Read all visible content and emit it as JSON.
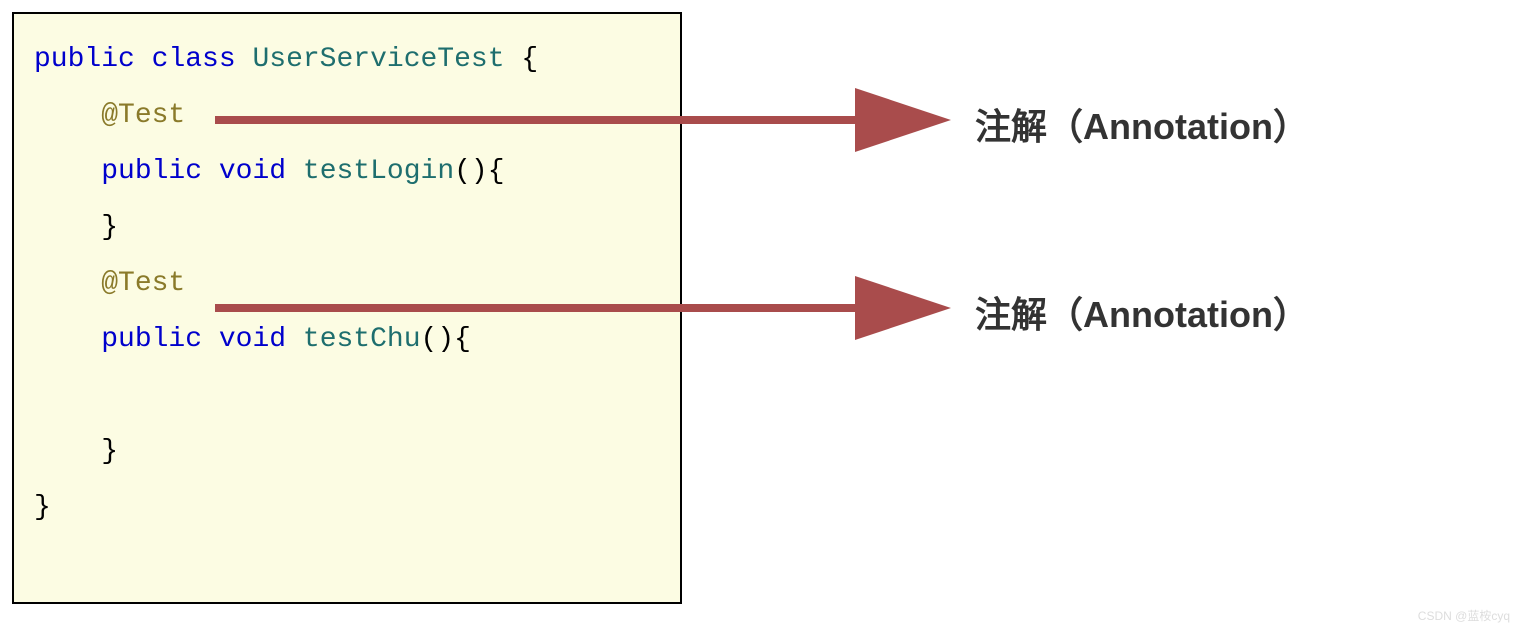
{
  "colors": {
    "keyword": "#0000cc",
    "identifier": "#1e6e6e",
    "annotation": "#8a7a2a",
    "plain": "#000000",
    "code_bg": "#fcfce3",
    "arrow": "#a94c4c",
    "label": "#333333"
  },
  "code": {
    "line1": {
      "kw1": "public",
      "sp1": " ",
      "kw2": "class",
      "sp2": " ",
      "id1": "UserServiceTest",
      "rest": " {"
    },
    "line2": {
      "indent": "    ",
      "anno": "@Test"
    },
    "line3": {
      "indent": "    ",
      "kw1": "public",
      "sp1": " ",
      "kw2": "void",
      "sp2": " ",
      "id1": "testLogin",
      "rest": "(){"
    },
    "line4": {
      "indent": "    ",
      "rest": "}"
    },
    "line5": {
      "indent": "    ",
      "anno": "@Test"
    },
    "line6": {
      "indent": "    ",
      "kw1": "public",
      "sp1": " ",
      "kw2": "void",
      "sp2": " ",
      "id1": "testChu",
      "rest": "(){"
    },
    "line7": {
      "indent": "",
      "rest": ""
    },
    "line8": {
      "indent": "    ",
      "rest": "}"
    },
    "line9": {
      "rest": "}"
    }
  },
  "callouts": {
    "c1": {
      "label": "注解（Annotation）"
    },
    "c2": {
      "label": "注解（Annotation）"
    }
  },
  "watermark": "CSDN @蓝桉cyq"
}
